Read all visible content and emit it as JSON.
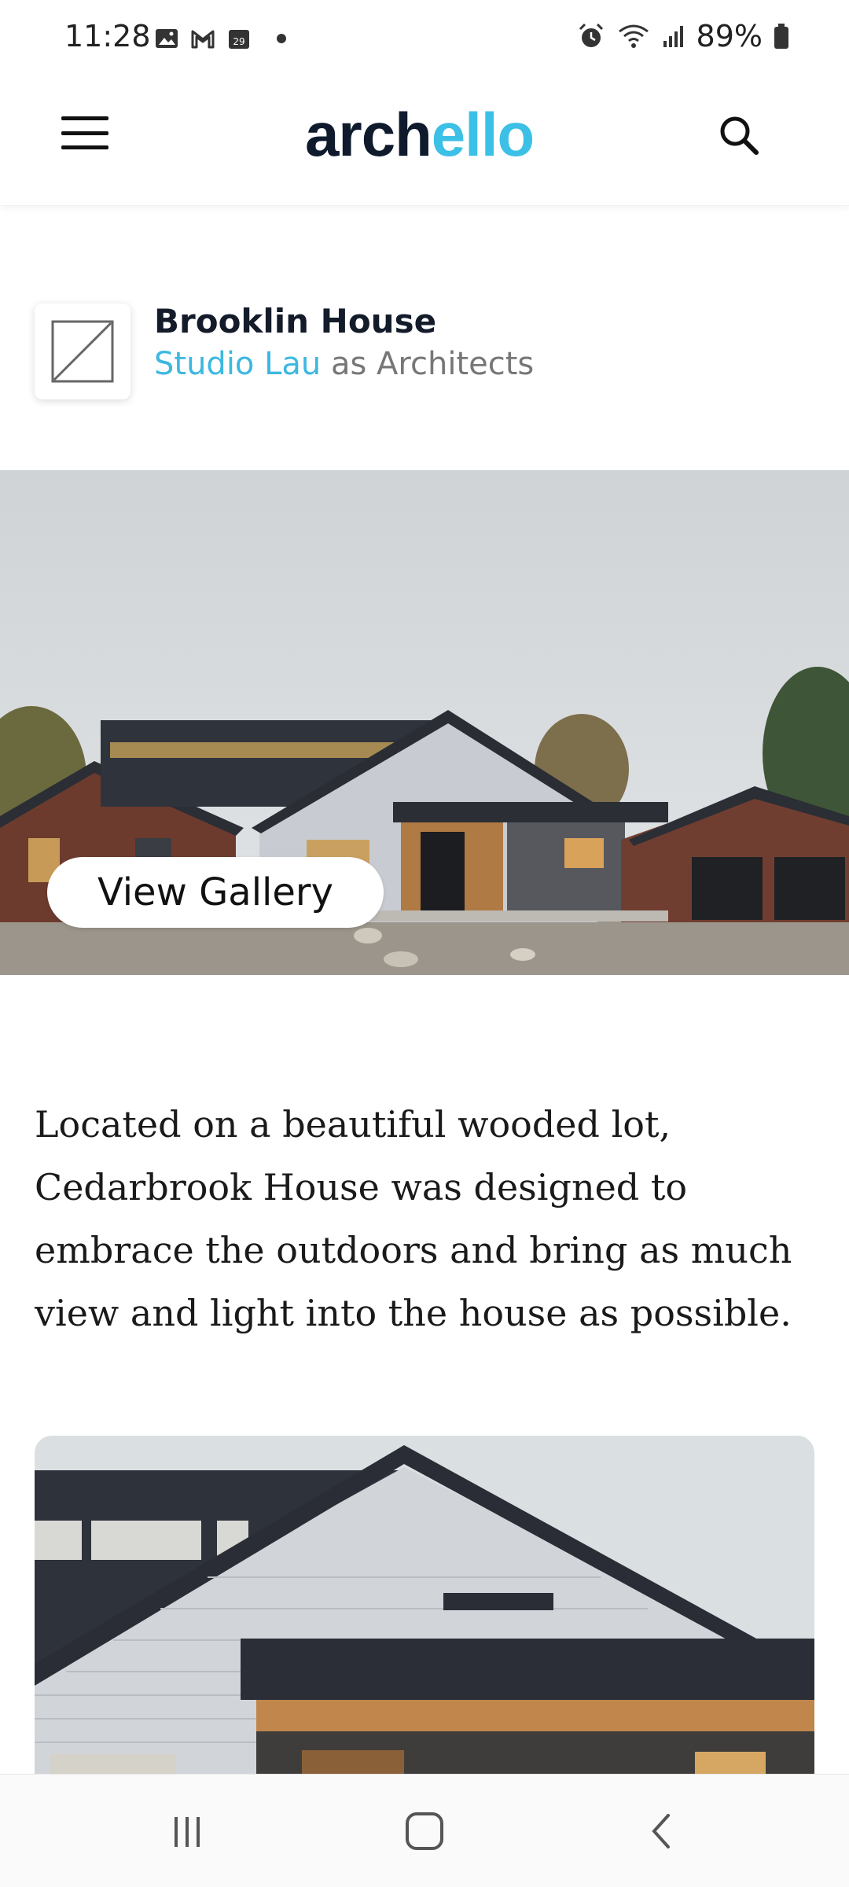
{
  "status_bar": {
    "time": "11:28",
    "battery": "89%",
    "calendar_day": "29",
    "icons_left": [
      "gallery-icon",
      "gmail-icon",
      "calendar-icon",
      "dot"
    ],
    "icons_right": [
      "alarm-icon",
      "wifi-icon",
      "signal-icon",
      "battery-icon"
    ]
  },
  "header": {
    "logo_part1": "arch",
    "logo_part2": "ello",
    "logo_h": "h",
    "brand_color": "#3cc0e6",
    "dark_color": "#0f1b2d"
  },
  "project": {
    "title": "Brooklin House",
    "studio": "Studio Lau",
    "role": " as Architects"
  },
  "hero": {
    "button_label": "View Gallery"
  },
  "description": "Located on a beautiful wooded lot, Cedarbrook House was designed to embrace the outdoors and bring as much view and light into the house as possible.",
  "nav": {
    "items": [
      "recents-icon",
      "home-icon",
      "back-icon"
    ]
  }
}
